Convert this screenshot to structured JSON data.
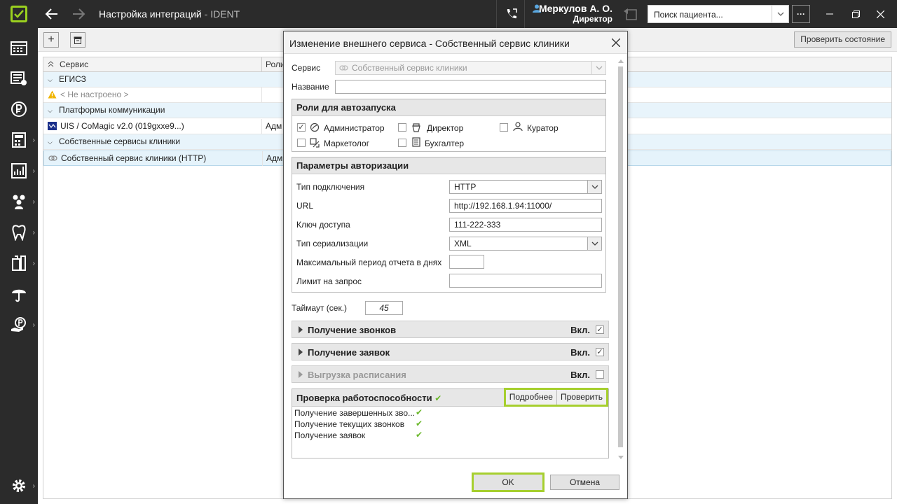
{
  "app": {
    "title": "Настройка интеграций",
    "subtitle": " - IDENT",
    "user_name": "Меркулов А. О.",
    "user_role": "Директор",
    "search_placeholder": "Поиск пациента...",
    "more_label": "···",
    "accent": "#a6cf2e"
  },
  "toolbar": {
    "add_label": "+",
    "check_state_label": "Проверить состояние"
  },
  "sidebar": {
    "items": [
      "schedule-icon",
      "records-icon",
      "finance-icon",
      "calculator-icon",
      "reports-icon",
      "patients-icon",
      "tooth-icon",
      "lab-icon",
      "insurance-icon",
      "payments-icon",
      "settings-icon"
    ]
  },
  "grid": {
    "columns": [
      "Сервис",
      "Роли"
    ],
    "rows": [
      {
        "type": "group",
        "text": "ЕГИСЗ"
      },
      {
        "type": "item",
        "text": "< Не настроено >",
        "role": "",
        "icon": "warning-icon"
      },
      {
        "type": "group",
        "text": "Платформы коммуникации"
      },
      {
        "type": "item",
        "text": "UIS / CoMagic v2.0 (019gxxe9...)",
        "role": "Адм",
        "icon": "uis-icon"
      },
      {
        "type": "group",
        "text": "Собственные сервисы клиники"
      },
      {
        "type": "item",
        "text": "Собственный сервис клиники (HTTP)",
        "role": "Адм",
        "icon": "service-icon"
      }
    ]
  },
  "dialog": {
    "title": "Изменение внешнего сервиса - Собственный сервис клиники",
    "service_label": "Сервис",
    "service_value": "Собственный сервис клиники",
    "name_label": "Название",
    "name_value": "",
    "roles_header": "Роли для автозапуска",
    "roles": [
      {
        "label": "Администратор",
        "checked": true
      },
      {
        "label": "Директор",
        "checked": false
      },
      {
        "label": "Куратор",
        "checked": false
      },
      {
        "label": "Маркетолог",
        "checked": false
      },
      {
        "label": "Бухгалтер",
        "checked": false
      }
    ],
    "auth_header": "Параметры авторизации",
    "conn_type_label": "Тип подключения",
    "conn_type_value": "HTTP",
    "url_label": "URL",
    "url_value": "http://192.168.1.94:11000/",
    "key_label": "Ключ доступа",
    "key_value": "111-222-333",
    "serial_label": "Тип сериализации",
    "serial_value": "XML",
    "max_period_label": "Максимальный период отчета в днях",
    "max_period_value": "",
    "limit_label": "Лимит на запрос",
    "limit_value": "",
    "timeout_label": "Таймаут (сек.)",
    "timeout_value": "45",
    "sections": [
      {
        "title": "Получение звонков",
        "on_label": "Вкл.",
        "checked": true,
        "disabled": false
      },
      {
        "title": "Получение заявок",
        "on_label": "Вкл.",
        "checked": true,
        "disabled": false
      },
      {
        "title": "Выгрузка расписания",
        "on_label": "Вкл.",
        "checked": false,
        "disabled": true
      }
    ],
    "health_header": "Проверка работоспособности",
    "details_label": "Подробнее",
    "check_label": "Проверить",
    "health_items": [
      "Получение завершенных зво...",
      "Получение текущих звонков",
      "Получение заявок"
    ],
    "ok_label": "OK",
    "cancel_label": "Отмена"
  }
}
